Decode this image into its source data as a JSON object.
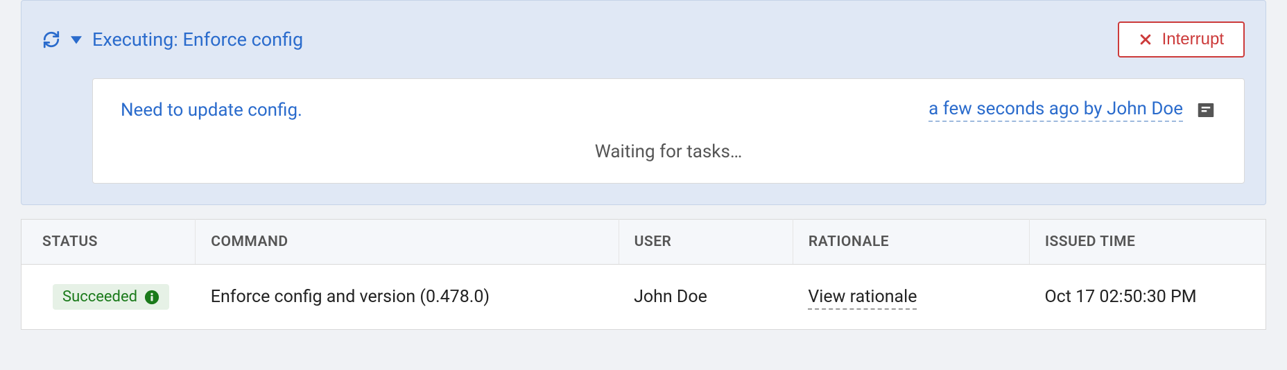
{
  "executing": {
    "title": "Executing: Enforce config",
    "interrupt_label": "Interrupt"
  },
  "message": {
    "text": "Need to update config.",
    "time_by": "a few seconds ago by John Doe",
    "waiting": "Waiting for tasks…"
  },
  "table": {
    "headers": {
      "status": "Status",
      "command": "Command",
      "user": "User",
      "rationale": "Rationale",
      "issued_time": "Issued Time"
    },
    "rows": [
      {
        "status": "Succeeded",
        "command": "Enforce config and version (0.478.0)",
        "user": "John Doe",
        "rationale": "View rationale",
        "issued_time": "Oct 17 02:50:30 PM"
      }
    ]
  }
}
